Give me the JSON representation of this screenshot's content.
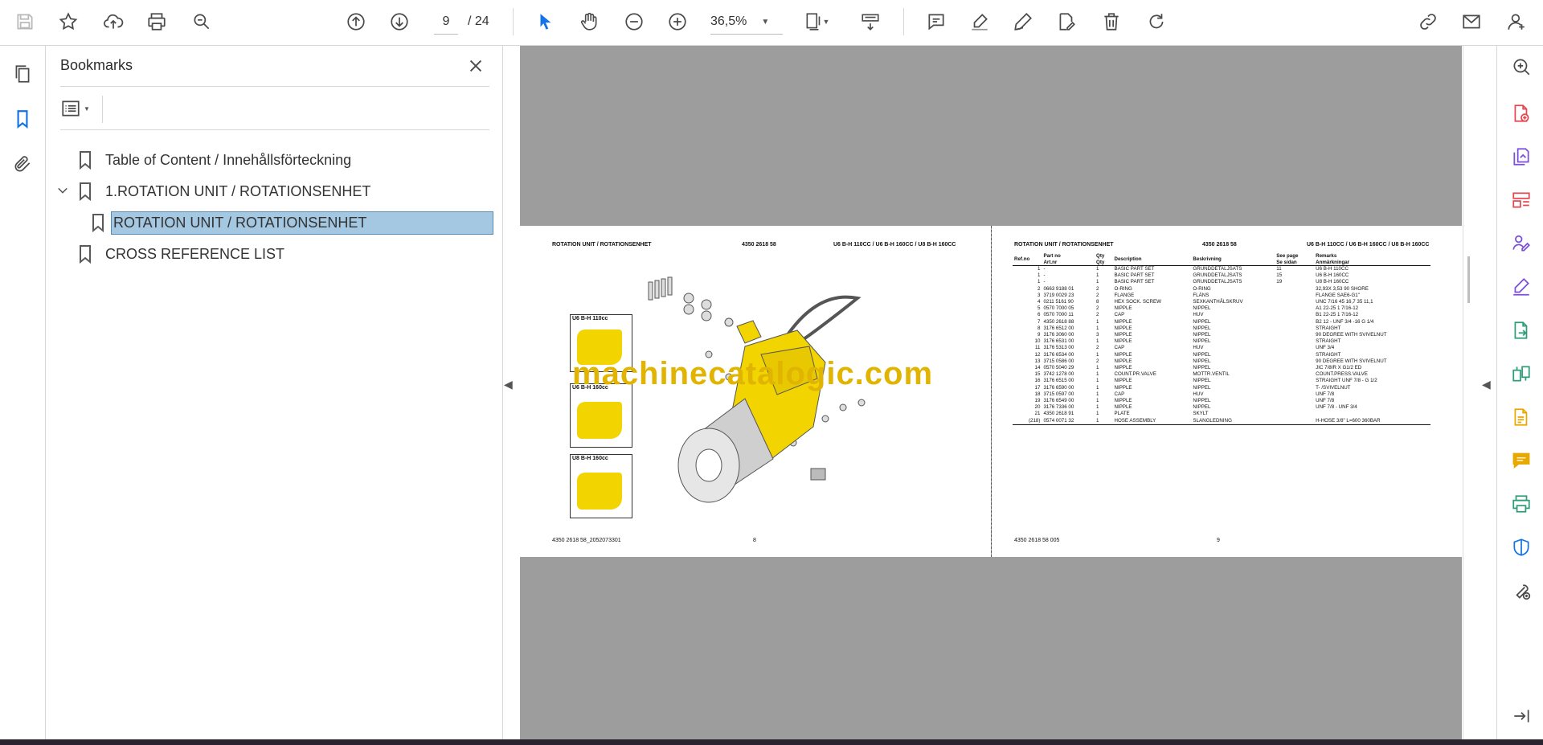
{
  "toolbar": {
    "page_current": "9",
    "page_total": "/ 24",
    "zoom": "36,5%"
  },
  "bookmarks_panel": {
    "title": "Bookmarks",
    "items": [
      {
        "label": "Table of Content / Innehållsförteckning"
      },
      {
        "label": "1.ROTATION UNIT / ROTATIONSENHET"
      },
      {
        "label": "ROTATION UNIT / ROTATIONSENHET"
      },
      {
        "label": "CROSS REFERENCE LIST"
      }
    ]
  },
  "colors": {
    "selection": "#a4c7e2",
    "accent_blue": "#1473e6",
    "rail_purple": "#7b4fd6",
    "rail_red": "#e34850",
    "rail_green": "#2d9d78",
    "rail_yellow": "#e8a800",
    "part_yellow": "#f2d400"
  },
  "document": {
    "watermark": "machinecatalogic.com",
    "left_page": {
      "header_left": "ROTATION UNIT / ROTATIONSENHET",
      "header_mid": "4350 2618 58",
      "header_right": "U6 B-H 110CC / U6 B-H 160CC / U8 B-H 160CC",
      "variant_labels": [
        "U6 B-H 110cc",
        "U6 B-H 160cc",
        "U8 B-H 160cc"
      ],
      "footer_left": "4350 2618 58_2052073301",
      "footer_page": "8"
    },
    "right_page": {
      "header_left": "ROTATION UNIT / ROTATIONSENHET",
      "header_mid": "4350 2618 58",
      "header_right": "U6 B-H 110CC / U6 B-H 160CC / U8 B-H 160CC",
      "columns": [
        "Ref.no",
        "Part no\nArt.nr",
        "Qty\nQty",
        "Description",
        "Beskrivning",
        "See page\nSe sidan",
        "Remarks\nAnmärkningar"
      ],
      "rows": [
        [
          "1",
          "-",
          "1",
          "BASIC PART SET",
          "GRUNDDETALJSATS",
          "11",
          "U6 B-H 110CC"
        ],
        [
          "1",
          "-",
          "1",
          "BASIC PART SET",
          "GRUNDDETALJSATS",
          "15",
          "U6 B-H 160CC"
        ],
        [
          "1",
          "-",
          "1",
          "BASIC PART SET",
          "GRUNDDETALJSATS",
          "19",
          "U8 B-H 160CC"
        ],
        [
          "2",
          "0663 9188 01",
          "2",
          "O-RING",
          "O-RING",
          "",
          "32,93X 3,53 90 SHORE"
        ],
        [
          "3",
          "3719 0029 23",
          "2",
          "FLANGE",
          "FLÄNS",
          "",
          "FLANGE SAE6-G1\""
        ],
        [
          "4",
          "0211 5161 90",
          "8",
          "HEX SOCK. SCREW",
          "SEXKANTHÅLSKRUV",
          "",
          "UNC 7/16 45 16,7 35 11,1"
        ],
        [
          "5",
          "0570 7000 05",
          "2",
          "NIPPLE",
          "NIPPEL",
          "",
          "A1 22-25 1 7/16-12"
        ],
        [
          "6",
          "0570 7000 11",
          "2",
          "CAP",
          "HUV",
          "",
          "B1 22-25 1 7/16-12"
        ],
        [
          "7",
          "4350 2618 88",
          "1",
          "NIPPLE",
          "NIPPEL",
          "",
          "B2 12 - UNF 3/4 -16 G 1/4"
        ],
        [
          "8",
          "3176 6512 00",
          "1",
          "NIPPLE",
          "NIPPEL",
          "",
          "STRAIGHT"
        ],
        [
          "9",
          "3176 3060 00",
          "3",
          "NIPPLE",
          "NIPPEL",
          "",
          "90 DEGREE WITH SVIVELNUT"
        ],
        [
          "10",
          "3176 6531 00",
          "1",
          "NIPPLE",
          "NIPPEL",
          "",
          "STRAIGHT"
        ],
        [
          "11",
          "3176 5313 00",
          "2",
          "CAP",
          "HUV",
          "",
          "UNF 3/4"
        ],
        [
          "12",
          "3176 6534 00",
          "1",
          "NIPPLE",
          "NIPPEL",
          "",
          "STRAIGHT"
        ],
        [
          "13",
          "3715 0586 00",
          "2",
          "NIPPLE",
          "NIPPEL",
          "",
          "90 DEGREE WITH SVIVELNUT"
        ],
        [
          "14",
          "0570 5040 29",
          "1",
          "NIPPLE",
          "NIPPEL",
          "",
          "JIC 7/8IR X G1/2 ED"
        ],
        [
          "15",
          "3742 1278 00",
          "1",
          "COUNT.PR.VALVE",
          "MOTTR.VENTIL",
          "",
          "COUNT.PRESS.VALVE"
        ],
        [
          "16",
          "3176 6515 00",
          "1",
          "NIPPLE",
          "NIPPEL",
          "",
          "STRAIGHT UNF 7/8 - G 1/2"
        ],
        [
          "17",
          "3176 6590 00",
          "1",
          "NIPPLE",
          "NIPPEL",
          "",
          "T- /SVIVELNUT"
        ],
        [
          "18",
          "3715 0597 00",
          "1",
          "CAP",
          "HUV",
          "",
          "UNF 7/8"
        ],
        [
          "19",
          "3176 6549 00",
          "1",
          "NIPPLE",
          "NIPPEL",
          "",
          "UNF 7/8"
        ],
        [
          "20",
          "3176 7336 00",
          "1",
          "NIPPLE",
          "NIPPEL",
          "",
          "UNF 7/8 - UNF 3/4"
        ],
        [
          "21",
          "4350 2618 91",
          "1",
          "PLATE",
          "SKYLT",
          "",
          ""
        ],
        [
          "(218)",
          "0574 0071 32",
          "1",
          "HOSE ASSEMBLY",
          "SLANGLEDNING",
          "",
          "H-HOSE 3/8\" L=600 360BAR"
        ]
      ],
      "footer_left": "4350 2618 58 005",
      "footer_page": "9"
    }
  }
}
